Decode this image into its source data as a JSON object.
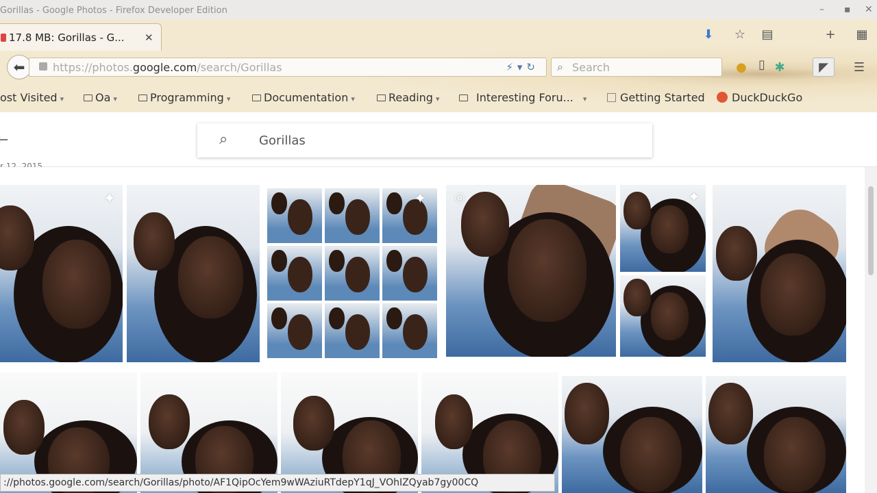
{
  "window": {
    "title": "Gorillas - Google Photos - Firefox Developer Edition"
  },
  "tab": {
    "label": "17.8 MB: Gorillas - G..."
  },
  "urlbar": {
    "prefix": "https://photos.",
    "domain": "google.com",
    "path": "/search/Gorillas"
  },
  "searchbar": {
    "placeholder": "Search"
  },
  "bookmarks": [
    {
      "label": "ost Visited"
    },
    {
      "label": "Oa"
    },
    {
      "label": "Programming"
    },
    {
      "label": "Documentation"
    },
    {
      "label": "Reading"
    },
    {
      "label": "Interesting Foru..."
    },
    {
      "label": "Getting Started"
    },
    {
      "label": "DuckDuckGo"
    }
  ],
  "photos_search": {
    "query": "Gorillas"
  },
  "date_label": "r 12, 2015",
  "status_url": "://photos.google.com/search/Gorillas/photo/AF1QipOcYem9wWAziuRTdepY1qJ_VOhIZQyab7gy00CQ",
  "icons": [
    "back-arrow-icon",
    "lock-icon",
    "reload-icon",
    "search-icon",
    "download-icon",
    "star-icon",
    "bookmark-list-icon",
    "add-tab-icon",
    "menu-icon",
    "sparkle-icon"
  ]
}
